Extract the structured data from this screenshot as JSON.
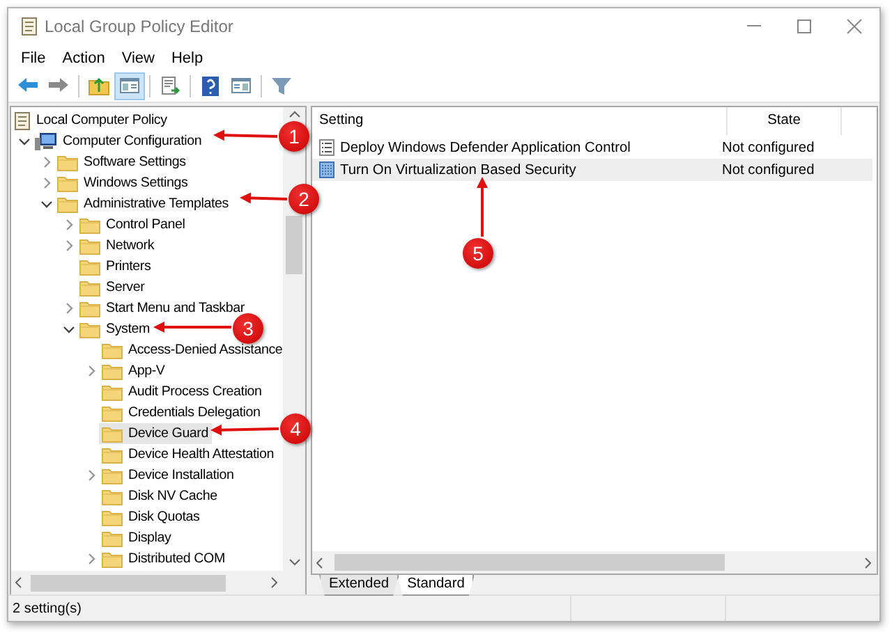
{
  "window": {
    "title": "Local Group Policy Editor"
  },
  "menu": [
    {
      "label": "File"
    },
    {
      "label": "Action"
    },
    {
      "label": "View"
    },
    {
      "label": "Help"
    }
  ],
  "toolbar": {
    "show_tree_pressed": true
  },
  "tree": [
    {
      "label": "Local Computer Policy",
      "kind": "policy",
      "selected": false,
      "children": [
        {
          "label": "Computer Configuration",
          "kind": "computer",
          "selected": false,
          "expanded": true,
          "children": [
            {
              "label": "Software Settings",
              "kind": "folder",
              "selected": false,
              "expanded": false
            },
            {
              "label": "Windows Settings",
              "kind": "folder",
              "selected": false,
              "expanded": false
            },
            {
              "label": "Administrative Templates",
              "kind": "folder",
              "selected": false,
              "expanded": true,
              "children": [
                {
                  "label": "Control Panel",
                  "kind": "folder",
                  "selected": false,
                  "expanded": false
                },
                {
                  "label": "Network",
                  "kind": "folder",
                  "selected": false,
                  "expanded": false
                },
                {
                  "label": "Printers",
                  "kind": "folder",
                  "selected": false
                },
                {
                  "label": "Server",
                  "kind": "folder",
                  "selected": false
                },
                {
                  "label": "Start Menu and Taskbar",
                  "kind": "folder",
                  "selected": false,
                  "expanded": false
                },
                {
                  "label": "System",
                  "kind": "folder",
                  "selected": false,
                  "expanded": true,
                  "children": [
                    {
                      "label": "Access-Denied Assistance",
                      "kind": "folder",
                      "selected": false
                    },
                    {
                      "label": "App-V",
                      "kind": "folder",
                      "selected": false,
                      "expanded": false
                    },
                    {
                      "label": "Audit Process Creation",
                      "kind": "folder",
                      "selected": false
                    },
                    {
                      "label": "Credentials Delegation",
                      "kind": "folder",
                      "selected": false
                    },
                    {
                      "label": "Device Guard",
                      "kind": "folder",
                      "selected": true
                    },
                    {
                      "label": "Device Health Attestation",
                      "kind": "folder",
                      "selected": false
                    },
                    {
                      "label": "Device Installation",
                      "kind": "folder",
                      "selected": false,
                      "expanded": false
                    },
                    {
                      "label": "Disk NV Cache",
                      "kind": "folder",
                      "selected": false
                    },
                    {
                      "label": "Disk Quotas",
                      "kind": "folder",
                      "selected": false
                    },
                    {
                      "label": "Display",
                      "kind": "folder",
                      "selected": false
                    },
                    {
                      "label": "Distributed COM",
                      "kind": "folder",
                      "selected": false,
                      "expanded": false
                    }
                  ]
                }
              ]
            }
          ]
        }
      ]
    }
  ],
  "table": {
    "columns": [
      "Setting",
      "State"
    ],
    "rows": [
      {
        "setting": "Deploy Windows Defender Application Control",
        "state": "Not configured",
        "kind": "list",
        "selected": false
      },
      {
        "setting": "Turn On Virtualization Based Security",
        "state": "Not configured",
        "kind": "grid",
        "selected": true
      }
    ]
  },
  "tabs": [
    {
      "label": "Extended",
      "selected": false
    },
    {
      "label": "Standard",
      "selected": true
    }
  ],
  "status_bar": {
    "text": "2 setting(s)"
  },
  "annotations": [
    {
      "label": "1"
    },
    {
      "label": "2"
    },
    {
      "label": "3"
    },
    {
      "label": "4"
    },
    {
      "label": "5"
    }
  ]
}
